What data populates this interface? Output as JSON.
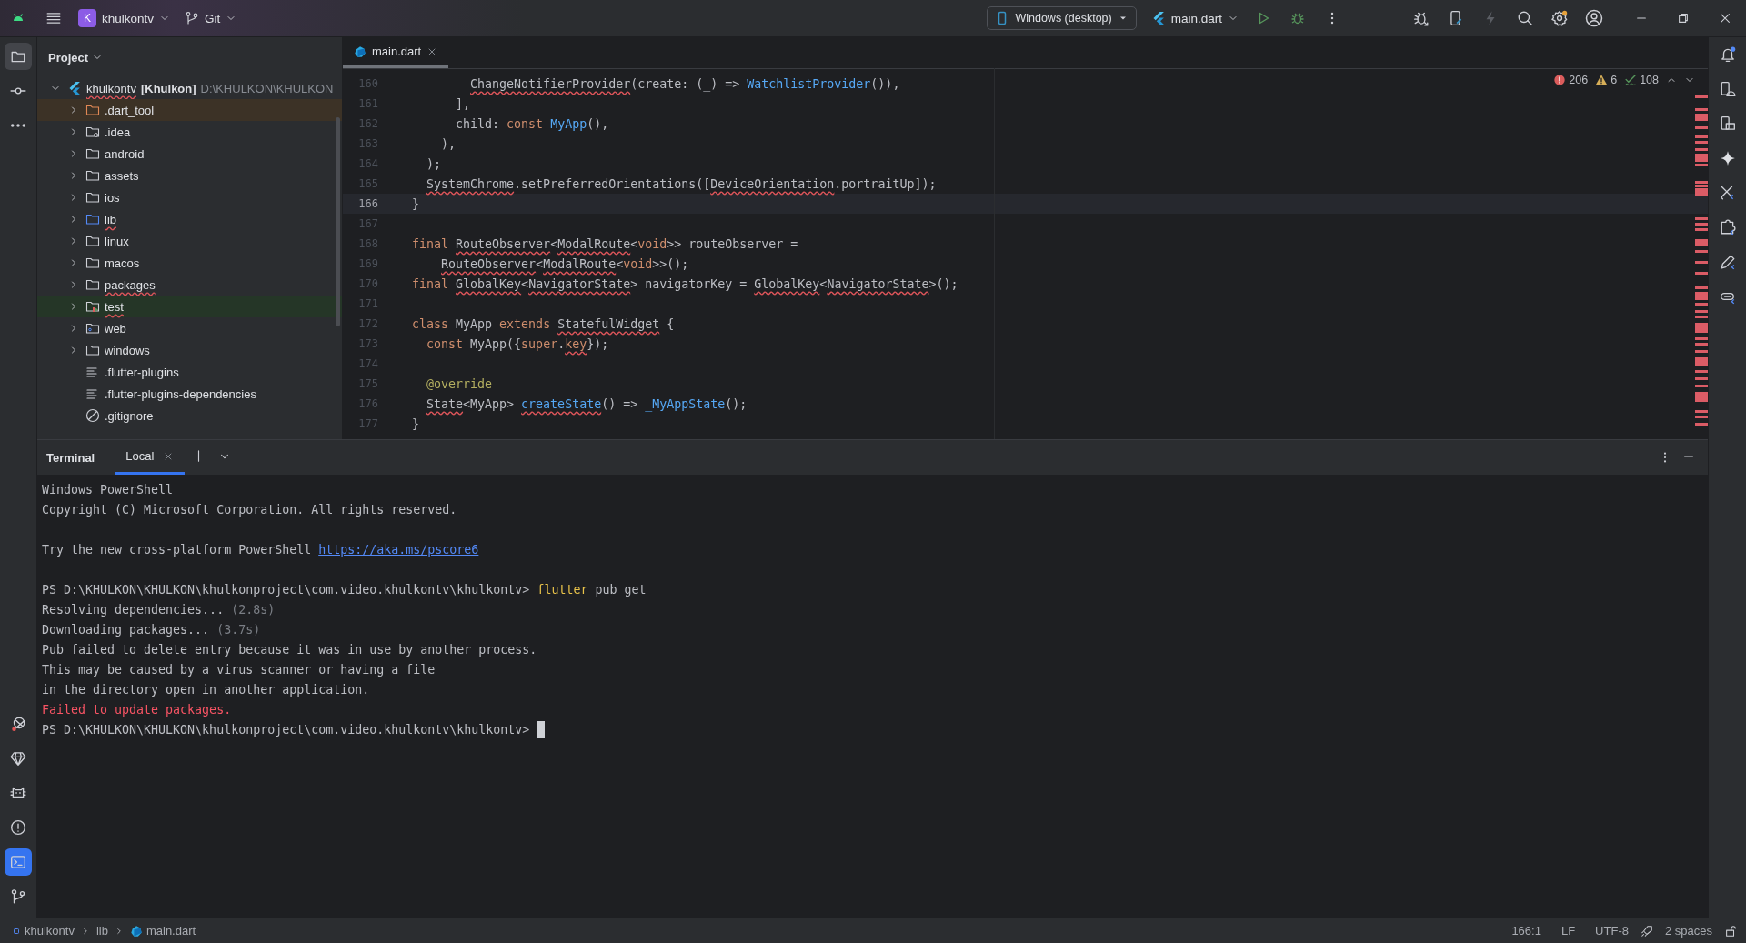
{
  "title_bar": {
    "project_badge": "K",
    "project": "khulkontv",
    "vcs": "Git",
    "device": "Windows (desktop)",
    "run_config": "main.dart"
  },
  "left_toolbar": {
    "top": [
      {
        "kind": "project",
        "selected": true
      },
      {
        "kind": "commit",
        "selected": false
      },
      {
        "kind": "more",
        "selected": false
      }
    ],
    "bottom": [
      {
        "kind": "flutter-inspector",
        "selected": false
      },
      {
        "kind": "gem",
        "selected": false
      },
      {
        "kind": "cat",
        "selected": false
      },
      {
        "kind": "problems",
        "selected": false
      },
      {
        "kind": "terminal",
        "selected": true
      },
      {
        "kind": "git",
        "selected": false
      }
    ]
  },
  "project_panel": {
    "title": "Project",
    "tree": [
      {
        "label": "khulkontv",
        "suffix": "[Khulkon]",
        "path": "D:\\KHULKON\\KHULKON",
        "kind": "module",
        "expanded": true,
        "error": true,
        "children": [
          {
            "label": ".dart_tool",
            "kind": "excluded_folder",
            "expanded": false,
            "error": false
          },
          {
            "label": ".idea",
            "kind": "config_folder",
            "expanded": false,
            "error": false
          },
          {
            "label": "android",
            "kind": "folder",
            "expanded": false,
            "error": false
          },
          {
            "label": "assets",
            "kind": "folder",
            "expanded": false,
            "error": false
          },
          {
            "label": "ios",
            "kind": "folder",
            "expanded": false,
            "error": false
          },
          {
            "label": "lib",
            "kind": "source_folder",
            "expanded": false,
            "error": true
          },
          {
            "label": "linux",
            "kind": "folder",
            "expanded": false,
            "error": false
          },
          {
            "label": "macos",
            "kind": "folder",
            "expanded": false,
            "error": false
          },
          {
            "label": "packages",
            "kind": "folder",
            "expanded": false,
            "error": true
          },
          {
            "label": "test",
            "kind": "test_folder",
            "expanded": false,
            "error": true
          },
          {
            "label": "web",
            "kind": "web_folder",
            "expanded": false,
            "error": false
          },
          {
            "label": "windows",
            "kind": "folder",
            "expanded": false,
            "error": false
          },
          {
            "label": ".flutter-plugins",
            "kind": "file",
            "error": false
          },
          {
            "label": ".flutter-plugins-dependencies",
            "kind": "file",
            "error": false
          },
          {
            "label": ".gitignore",
            "kind": "ignore_file",
            "error": false
          }
        ]
      }
    ]
  },
  "editor": {
    "tabs": [
      {
        "label": "main.dart",
        "selected": true
      }
    ],
    "inspections": {
      "errors": "206",
      "warnings": "6",
      "typos": "108"
    },
    "lines": [
      {
        "number": "160",
        "current": false,
        "segments": [
          {
            "text": "        ChangeNotifierProvider",
            "kind": "error"
          },
          {
            "text": "(create: (_) => ",
            "kind": "plain"
          },
          {
            "text": "WatchlistProvider",
            "kind": "call"
          },
          {
            "text": "()),",
            "kind": "plain"
          }
        ]
      },
      {
        "number": "161",
        "current": false,
        "segments": [
          {
            "text": "      ],",
            "kind": "plain"
          }
        ]
      },
      {
        "number": "162",
        "current": false,
        "segments": [
          {
            "text": "      child: ",
            "kind": "plain"
          },
          {
            "text": "const",
            "kind": "keyword"
          },
          {
            "text": " MyApp",
            "kind": "call"
          },
          {
            "text": "(),",
            "kind": "plain"
          }
        ]
      },
      {
        "number": "163",
        "current": false,
        "segments": [
          {
            "text": "    ),",
            "kind": "plain"
          }
        ]
      },
      {
        "number": "164",
        "current": false,
        "segments": [
          {
            "text": "  );",
            "kind": "plain"
          }
        ]
      },
      {
        "number": "165",
        "current": false,
        "segments": [
          {
            "text": "  SystemChrome",
            "kind": "error"
          },
          {
            "text": ".setPreferredOrientations([",
            "kind": "plain"
          },
          {
            "text": "DeviceOrientation",
            "kind": "error"
          },
          {
            "text": ".portraitUp]);",
            "kind": "plain"
          }
        ]
      },
      {
        "number": "166",
        "current": true,
        "segments": [
          {
            "text": "}",
            "kind": "plain"
          }
        ]
      },
      {
        "number": "167",
        "current": false
      },
      {
        "number": "168",
        "current": false,
        "segments": [
          {
            "text": "final",
            "kind": "keyword"
          },
          {
            "text": " RouteObserver",
            "kind": "error"
          },
          {
            "text": "<",
            "kind": "plain"
          },
          {
            "text": "ModalRoute",
            "kind": "error"
          },
          {
            "text": "<",
            "kind": "plain"
          },
          {
            "text": "void",
            "kind": "keyword"
          },
          {
            "text": ">> routeObserver =",
            "kind": "plain"
          }
        ]
      },
      {
        "number": "169",
        "current": false,
        "segments": [
          {
            "text": "    RouteObserver",
            "kind": "error"
          },
          {
            "text": "<",
            "kind": "plain"
          },
          {
            "text": "ModalRoute",
            "kind": "error"
          },
          {
            "text": "<",
            "kind": "plain"
          },
          {
            "text": "void",
            "kind": "keyword"
          },
          {
            "text": ">>();",
            "kind": "plain"
          }
        ]
      },
      {
        "number": "170",
        "current": false,
        "segments": [
          {
            "text": "final",
            "kind": "keyword"
          },
          {
            "text": " GlobalKey",
            "kind": "error"
          },
          {
            "text": "<",
            "kind": "plain"
          },
          {
            "text": "NavigatorState",
            "kind": "error"
          },
          {
            "text": "> navigatorKey = ",
            "kind": "plain"
          },
          {
            "text": "GlobalKey",
            "kind": "error"
          },
          {
            "text": "<",
            "kind": "plain"
          },
          {
            "text": "NavigatorState",
            "kind": "error"
          },
          {
            "text": ">();",
            "kind": "plain"
          }
        ]
      },
      {
        "number": "171",
        "current": false
      },
      {
        "number": "172",
        "current": false,
        "segments": [
          {
            "text": "class",
            "kind": "keyword"
          },
          {
            "text": " MyApp ",
            "kind": "plain"
          },
          {
            "text": "extends",
            "kind": "keyword"
          },
          {
            "text": " StatefulWidget",
            "kind": "error"
          },
          {
            "text": " {",
            "kind": "plain"
          }
        ]
      },
      {
        "number": "173",
        "current": false,
        "segments": [
          {
            "text": "  const",
            "kind": "keyword"
          },
          {
            "text": " MyApp({",
            "kind": "plain"
          },
          {
            "text": "super",
            "kind": "keyword"
          },
          {
            "text": ".",
            "kind": "plain"
          },
          {
            "text": "key",
            "kind": "error_keyword"
          },
          {
            "text": "});",
            "kind": "plain"
          }
        ]
      },
      {
        "number": "174",
        "current": false
      },
      {
        "number": "175",
        "current": false,
        "segments": [
          {
            "text": "  @override",
            "kind": "annotation"
          }
        ]
      },
      {
        "number": "176",
        "current": false,
        "segments": [
          {
            "text": "  State",
            "kind": "error"
          },
          {
            "text": "<MyApp> ",
            "kind": "plain"
          },
          {
            "text": "createState",
            "kind": "error_call"
          },
          {
            "text": "() => ",
            "kind": "plain"
          },
          {
            "text": "_MyAppState",
            "kind": "call"
          },
          {
            "text": "();",
            "kind": "plain"
          }
        ]
      },
      {
        "number": "177",
        "current": false,
        "segments": [
          {
            "text": "}",
            "kind": "plain"
          }
        ]
      }
    ]
  },
  "terminal": {
    "title": "Terminal",
    "tabs": [
      {
        "label": "Local",
        "selected": true
      }
    ],
    "cursor": true,
    "lines": [
      {
        "kind": "text",
        "segments": [
          {
            "text": "Windows PowerShell",
            "kind": "plain"
          }
        ]
      },
      {
        "kind": "text",
        "segments": [
          {
            "text": "Copyright (C) Microsoft Corporation. All rights reserved.",
            "kind": "plain"
          }
        ]
      },
      {
        "kind": "blank"
      },
      {
        "kind": "text",
        "segments": [
          {
            "text": "Try the new cross-platform PowerShell ",
            "kind": "plain"
          },
          {
            "text": "https://aka.ms/pscore6",
            "kind": "link"
          }
        ]
      },
      {
        "kind": "blank"
      },
      {
        "kind": "text",
        "segments": [
          {
            "text": "PS D:\\KHULKON\\KHULKON\\khulkonproject\\com.video.khulkontv\\khulkontv> ",
            "kind": "plain"
          },
          {
            "text": "flutter",
            "kind": "command"
          },
          {
            "text": " pub get",
            "kind": "plain"
          }
        ]
      },
      {
        "kind": "text",
        "segments": [
          {
            "text": "Resolving dependencies... ",
            "kind": "plain"
          },
          {
            "text": "(2.8s)",
            "kind": "dim"
          }
        ]
      },
      {
        "kind": "text",
        "segments": [
          {
            "text": "Downloading packages... ",
            "kind": "plain"
          },
          {
            "text": "(3.7s)",
            "kind": "dim"
          }
        ]
      },
      {
        "kind": "text",
        "segments": [
          {
            "text": "Pub failed to delete entry because it was in use by another process.",
            "kind": "plain"
          }
        ]
      },
      {
        "kind": "text",
        "segments": [
          {
            "text": "This may be caused by a virus scanner or having a file",
            "kind": "plain"
          }
        ]
      },
      {
        "kind": "text",
        "segments": [
          {
            "text": "in the directory open in another application.",
            "kind": "plain"
          }
        ]
      },
      {
        "kind": "text",
        "segments": [
          {
            "text": "Failed to update packages.",
            "kind": "error"
          }
        ]
      },
      {
        "kind": "text",
        "segments": [
          {
            "text": "PS D:\\KHULKON\\KHULKON\\khulkonproject\\com.video.khulkontv\\khulkontv> ",
            "kind": "plain"
          }
        ]
      }
    ]
  },
  "status_bar": {
    "breadcrumbs": [
      {
        "label": "khulkontv",
        "kind": "module"
      },
      {
        "label": "lib",
        "kind": "folder"
      },
      {
        "label": "main.dart",
        "kind": "dart"
      }
    ],
    "position": "166:1",
    "line_separator": "LF",
    "encoding": "UTF-8",
    "indent": "2 spaces"
  }
}
